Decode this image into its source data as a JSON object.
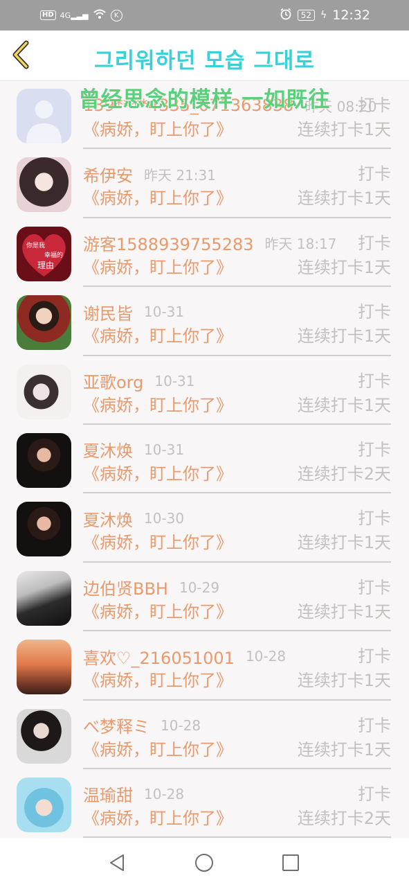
{
  "status_bar": {
    "hd": "HD",
    "signal": "4G",
    "k_badge": "K",
    "battery": "52",
    "time": "12:32"
  },
  "header": {
    "title_line1": "그리워하던 모습 그대로",
    "title_line2": "曾经思念的模样 一如既往"
  },
  "colors": {
    "accent_name": "#e89a6c",
    "muted": "#c4c0c0",
    "title_cyan": "#3ad0d8",
    "title_green": "#5bd07b"
  },
  "entries": [
    {
      "name": "139****4335_071363838",
      "time": "昨天 08:20",
      "action": "打卡",
      "book": "《病娇，盯上你了》",
      "streak": "连续打卡1天"
    },
    {
      "name": "希伊安",
      "time": "昨天 21:31",
      "action": "打卡",
      "book": "《病娇，盯上你了》",
      "streak": "连续打卡1天"
    },
    {
      "name": "游客1588939755283",
      "time": "昨天 18:17",
      "action": "打卡",
      "book": "《病娇，盯上你了》",
      "streak": "连续打卡1天"
    },
    {
      "name": "谢民皆",
      "time": "10-31",
      "action": "打卡",
      "book": "《病娇，盯上你了》",
      "streak": "连续打卡1天"
    },
    {
      "name": "亚歌org",
      "time": "10-31",
      "action": "打卡",
      "book": "《病娇，盯上你了》",
      "streak": "连续打卡1天"
    },
    {
      "name": "夏沐焕",
      "time": "10-31",
      "action": "打卡",
      "book": "《病娇，盯上你了》",
      "streak": "连续打卡2天"
    },
    {
      "name": "夏沐焕",
      "time": "10-30",
      "action": "打卡",
      "book": "《病娇，盯上你了》",
      "streak": "连续打卡1天"
    },
    {
      "name": "边伯贤BBH",
      "time": "10-29",
      "action": "打卡",
      "book": "《病娇，盯上你了》",
      "streak": "连续打卡1天"
    },
    {
      "name": "喜欢♡_216051001",
      "time": "10-28",
      "action": "打卡",
      "book": "《病娇，盯上你了》",
      "streak": "连续打卡1天"
    },
    {
      "name": "べ梦释ミ",
      "time": "10-28",
      "action": "打卡",
      "book": "《病娇，盯上你了》",
      "streak": "连续打卡1天"
    },
    {
      "name": "温瑜甜",
      "time": "10-28",
      "action": "打卡",
      "book": "《病娇，盯上你了》",
      "streak": "连续打卡2天"
    }
  ],
  "avatar_texts": {
    "heart_line1": "你是我",
    "heart_line2": "幸福的",
    "heart_line3": "理由"
  },
  "nav": {
    "back_icon": "triangle-back-icon",
    "home_icon": "circle-home-icon",
    "recents_icon": "square-recents-icon"
  }
}
